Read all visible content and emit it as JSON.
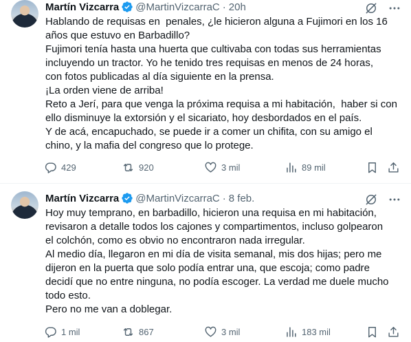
{
  "tweets": [
    {
      "author_name": "Martín Vizcarra",
      "handle": "@MartinVizcarraC",
      "dot": "·",
      "time": "20h",
      "lines": [
        "Hablando de requisas en  penales, ¿le hicieron alguna a Fujimori en los 16",
        "años que estuvo en Barbadillo?",
        "Fujimori tenía hasta una huerta que cultivaba con todas sus herramientas",
        "incluyendo un tractor. Yo he tenido tres requisas en menos de 24 horas,",
        "con fotos publicadas al día siguiente en la prensa.",
        "¡La orden viene de arriba!",
        "Reto a Jerí, para que venga la próxima requisa a mi habitación,  haber si con",
        "ello disminuye la extorsión y el sicariato, hoy desbordados en el país.",
        "Y de acá, encapuchado, se puede ir a comer un chifita, con su amigo el",
        "chino, y la mafia del congreso que lo protege."
      ],
      "replies": "429",
      "retweets": "920",
      "likes": "3 mil",
      "views": "89 mil"
    },
    {
      "author_name": "Martín Vizcarra",
      "handle": "@MartinVizcarraC",
      "dot": "·",
      "time": "8 feb.",
      "lines": [
        "Hoy muy temprano, en barbadillo, hicieron una requisa en mi habitación,",
        "revisaron a detalle todos los cajones y compartimentos, incluso golpearon",
        "el colchón, como es obvio no encontraron nada irregular.",
        "Al medio día, llegaron en mi día de visita semanal, mis dos hijas; pero me",
        "dijeron en la puerta que solo podía entrar una, que escoja; como padre",
        "decidí que no entre ninguna, no podía escoger. La verdad me duele mucho",
        "todo esto.",
        "Pero no me van a doblegar."
      ],
      "replies": "1 mil",
      "retweets": "867",
      "likes": "3 mil",
      "views": "183 mil"
    }
  ],
  "colors": {
    "text": "#0f1419",
    "secondary": "#536471",
    "verified": "#1d9bf0",
    "divider": "#eff3f4"
  },
  "icons": [
    "verified-badge-icon",
    "grok-icon",
    "more-icon",
    "reply-icon",
    "retweet-icon",
    "like-icon",
    "views-icon",
    "bookmark-icon",
    "share-icon"
  ]
}
